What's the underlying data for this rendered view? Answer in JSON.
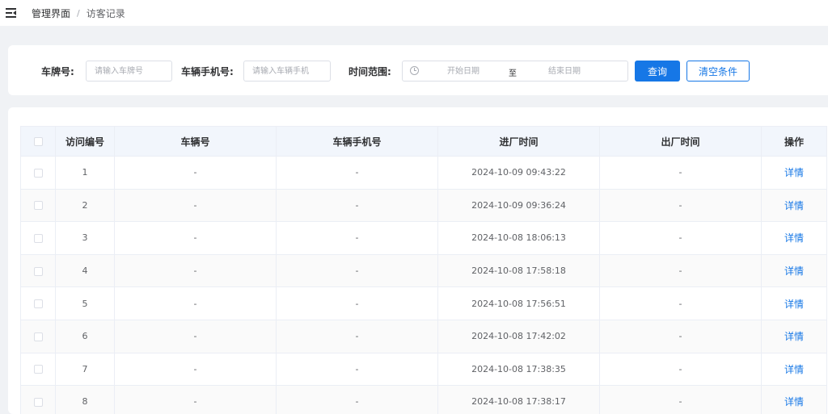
{
  "breadcrumb": {
    "home": "管理界面",
    "separator": "/",
    "current": "访客记录"
  },
  "filters": {
    "plate_label": "车牌号:",
    "plate_placeholder": "请输入车牌号",
    "phone_label": "车辆手机号:",
    "phone_placeholder": "请输入车辆手机",
    "time_label": "时间范围:",
    "date_start_placeholder": "开始日期",
    "date_separator": "至",
    "date_end_placeholder": "结束日期",
    "query_button": "查询",
    "clear_button": "清空条件"
  },
  "table": {
    "headers": [
      "访问编号",
      "车辆号",
      "车辆手机号",
      "进厂时间",
      "出厂时间",
      "操作"
    ],
    "rows": [
      {
        "id": "1",
        "plate": "-",
        "phone": "-",
        "entry": "2024-10-09 09:43:22",
        "exit": "-",
        "action": "详情"
      },
      {
        "id": "2",
        "plate": "-",
        "phone": "-",
        "entry": "2024-10-09 09:36:24",
        "exit": "-",
        "action": "详情"
      },
      {
        "id": "3",
        "plate": "-",
        "phone": "-",
        "entry": "2024-10-08 18:06:13",
        "exit": "-",
        "action": "详情"
      },
      {
        "id": "4",
        "plate": "-",
        "phone": "-",
        "entry": "2024-10-08 17:58:18",
        "exit": "-",
        "action": "详情"
      },
      {
        "id": "5",
        "plate": "-",
        "phone": "-",
        "entry": "2024-10-08 17:56:51",
        "exit": "-",
        "action": "详情"
      },
      {
        "id": "6",
        "plate": "-",
        "phone": "-",
        "entry": "2024-10-08 17:42:02",
        "exit": "-",
        "action": "详情"
      },
      {
        "id": "7",
        "plate": "-",
        "phone": "-",
        "entry": "2024-10-08 17:38:35",
        "exit": "-",
        "action": "详情"
      },
      {
        "id": "8",
        "plate": "-",
        "phone": "-",
        "entry": "2024-10-08 17:38:17",
        "exit": "-",
        "action": "详情"
      }
    ]
  },
  "colors": {
    "primary": "#1677e6",
    "header_bg": "#f2f6fc",
    "page_bg": "#f0f2f5"
  },
  "icons": {
    "menu": "menu-fold-icon",
    "date": "clock-icon"
  }
}
